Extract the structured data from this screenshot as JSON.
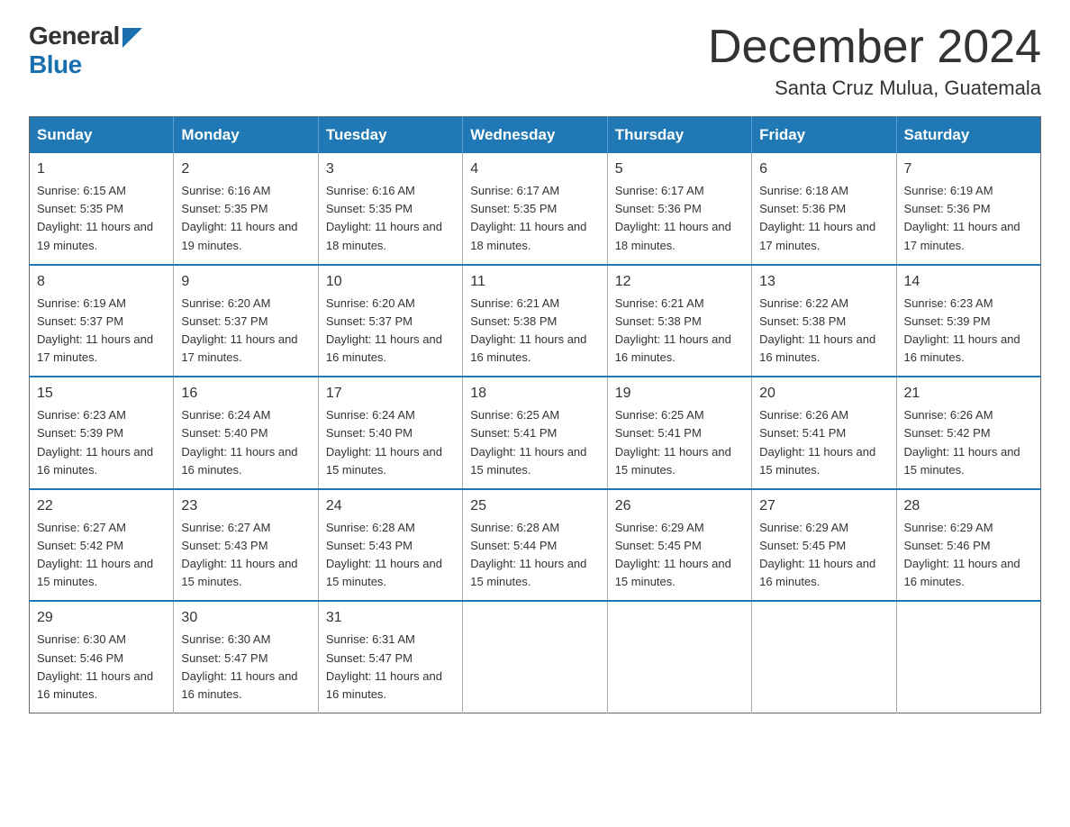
{
  "logo": {
    "general": "General",
    "blue": "Blue"
  },
  "title": {
    "month": "December 2024",
    "location": "Santa Cruz Mulua, Guatemala"
  },
  "headers": [
    "Sunday",
    "Monday",
    "Tuesday",
    "Wednesday",
    "Thursday",
    "Friday",
    "Saturday"
  ],
  "weeks": [
    [
      {
        "day": "1",
        "sunrise": "Sunrise: 6:15 AM",
        "sunset": "Sunset: 5:35 PM",
        "daylight": "Daylight: 11 hours and 19 minutes."
      },
      {
        "day": "2",
        "sunrise": "Sunrise: 6:16 AM",
        "sunset": "Sunset: 5:35 PM",
        "daylight": "Daylight: 11 hours and 19 minutes."
      },
      {
        "day": "3",
        "sunrise": "Sunrise: 6:16 AM",
        "sunset": "Sunset: 5:35 PM",
        "daylight": "Daylight: 11 hours and 18 minutes."
      },
      {
        "day": "4",
        "sunrise": "Sunrise: 6:17 AM",
        "sunset": "Sunset: 5:35 PM",
        "daylight": "Daylight: 11 hours and 18 minutes."
      },
      {
        "day": "5",
        "sunrise": "Sunrise: 6:17 AM",
        "sunset": "Sunset: 5:36 PM",
        "daylight": "Daylight: 11 hours and 18 minutes."
      },
      {
        "day": "6",
        "sunrise": "Sunrise: 6:18 AM",
        "sunset": "Sunset: 5:36 PM",
        "daylight": "Daylight: 11 hours and 17 minutes."
      },
      {
        "day": "7",
        "sunrise": "Sunrise: 6:19 AM",
        "sunset": "Sunset: 5:36 PM",
        "daylight": "Daylight: 11 hours and 17 minutes."
      }
    ],
    [
      {
        "day": "8",
        "sunrise": "Sunrise: 6:19 AM",
        "sunset": "Sunset: 5:37 PM",
        "daylight": "Daylight: 11 hours and 17 minutes."
      },
      {
        "day": "9",
        "sunrise": "Sunrise: 6:20 AM",
        "sunset": "Sunset: 5:37 PM",
        "daylight": "Daylight: 11 hours and 17 minutes."
      },
      {
        "day": "10",
        "sunrise": "Sunrise: 6:20 AM",
        "sunset": "Sunset: 5:37 PM",
        "daylight": "Daylight: 11 hours and 16 minutes."
      },
      {
        "day": "11",
        "sunrise": "Sunrise: 6:21 AM",
        "sunset": "Sunset: 5:38 PM",
        "daylight": "Daylight: 11 hours and 16 minutes."
      },
      {
        "day": "12",
        "sunrise": "Sunrise: 6:21 AM",
        "sunset": "Sunset: 5:38 PM",
        "daylight": "Daylight: 11 hours and 16 minutes."
      },
      {
        "day": "13",
        "sunrise": "Sunrise: 6:22 AM",
        "sunset": "Sunset: 5:38 PM",
        "daylight": "Daylight: 11 hours and 16 minutes."
      },
      {
        "day": "14",
        "sunrise": "Sunrise: 6:23 AM",
        "sunset": "Sunset: 5:39 PM",
        "daylight": "Daylight: 11 hours and 16 minutes."
      }
    ],
    [
      {
        "day": "15",
        "sunrise": "Sunrise: 6:23 AM",
        "sunset": "Sunset: 5:39 PM",
        "daylight": "Daylight: 11 hours and 16 minutes."
      },
      {
        "day": "16",
        "sunrise": "Sunrise: 6:24 AM",
        "sunset": "Sunset: 5:40 PM",
        "daylight": "Daylight: 11 hours and 16 minutes."
      },
      {
        "day": "17",
        "sunrise": "Sunrise: 6:24 AM",
        "sunset": "Sunset: 5:40 PM",
        "daylight": "Daylight: 11 hours and 15 minutes."
      },
      {
        "day": "18",
        "sunrise": "Sunrise: 6:25 AM",
        "sunset": "Sunset: 5:41 PM",
        "daylight": "Daylight: 11 hours and 15 minutes."
      },
      {
        "day": "19",
        "sunrise": "Sunrise: 6:25 AM",
        "sunset": "Sunset: 5:41 PM",
        "daylight": "Daylight: 11 hours and 15 minutes."
      },
      {
        "day": "20",
        "sunrise": "Sunrise: 6:26 AM",
        "sunset": "Sunset: 5:41 PM",
        "daylight": "Daylight: 11 hours and 15 minutes."
      },
      {
        "day": "21",
        "sunrise": "Sunrise: 6:26 AM",
        "sunset": "Sunset: 5:42 PM",
        "daylight": "Daylight: 11 hours and 15 minutes."
      }
    ],
    [
      {
        "day": "22",
        "sunrise": "Sunrise: 6:27 AM",
        "sunset": "Sunset: 5:42 PM",
        "daylight": "Daylight: 11 hours and 15 minutes."
      },
      {
        "day": "23",
        "sunrise": "Sunrise: 6:27 AM",
        "sunset": "Sunset: 5:43 PM",
        "daylight": "Daylight: 11 hours and 15 minutes."
      },
      {
        "day": "24",
        "sunrise": "Sunrise: 6:28 AM",
        "sunset": "Sunset: 5:43 PM",
        "daylight": "Daylight: 11 hours and 15 minutes."
      },
      {
        "day": "25",
        "sunrise": "Sunrise: 6:28 AM",
        "sunset": "Sunset: 5:44 PM",
        "daylight": "Daylight: 11 hours and 15 minutes."
      },
      {
        "day": "26",
        "sunrise": "Sunrise: 6:29 AM",
        "sunset": "Sunset: 5:45 PM",
        "daylight": "Daylight: 11 hours and 15 minutes."
      },
      {
        "day": "27",
        "sunrise": "Sunrise: 6:29 AM",
        "sunset": "Sunset: 5:45 PM",
        "daylight": "Daylight: 11 hours and 16 minutes."
      },
      {
        "day": "28",
        "sunrise": "Sunrise: 6:29 AM",
        "sunset": "Sunset: 5:46 PM",
        "daylight": "Daylight: 11 hours and 16 minutes."
      }
    ],
    [
      {
        "day": "29",
        "sunrise": "Sunrise: 6:30 AM",
        "sunset": "Sunset: 5:46 PM",
        "daylight": "Daylight: 11 hours and 16 minutes."
      },
      {
        "day": "30",
        "sunrise": "Sunrise: 6:30 AM",
        "sunset": "Sunset: 5:47 PM",
        "daylight": "Daylight: 11 hours and 16 minutes."
      },
      {
        "day": "31",
        "sunrise": "Sunrise: 6:31 AM",
        "sunset": "Sunset: 5:47 PM",
        "daylight": "Daylight: 11 hours and 16 minutes."
      },
      null,
      null,
      null,
      null
    ]
  ]
}
